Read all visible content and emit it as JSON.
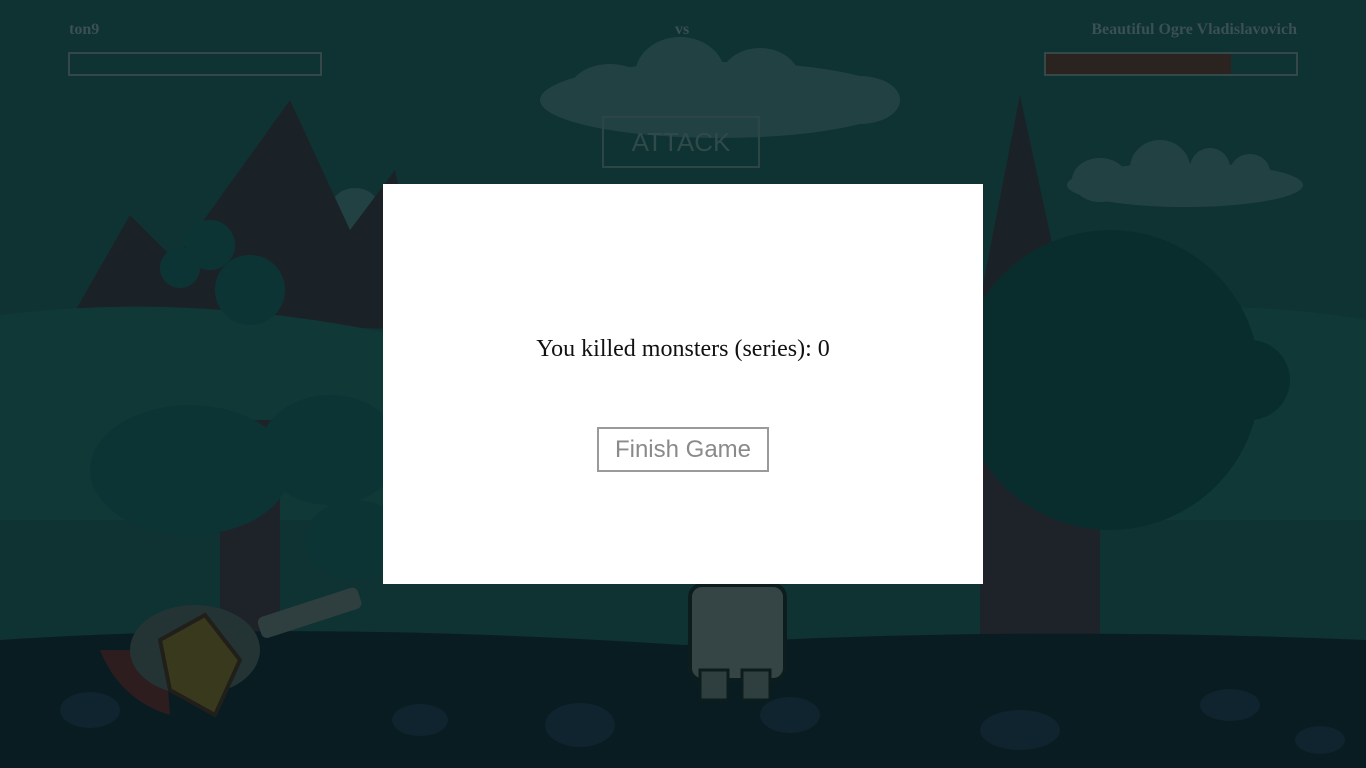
{
  "hud": {
    "player_name": "ton9",
    "vs_label": "vs",
    "enemy_name": "Beautiful Ogre Vladislavovich",
    "player_hp_fraction": 0.0,
    "enemy_hp_fraction": 0.74
  },
  "attack_button_label": "ATTACK",
  "modal": {
    "result_text": "You killed monsters (series): 0",
    "finish_button_label": "Finish Game"
  }
}
